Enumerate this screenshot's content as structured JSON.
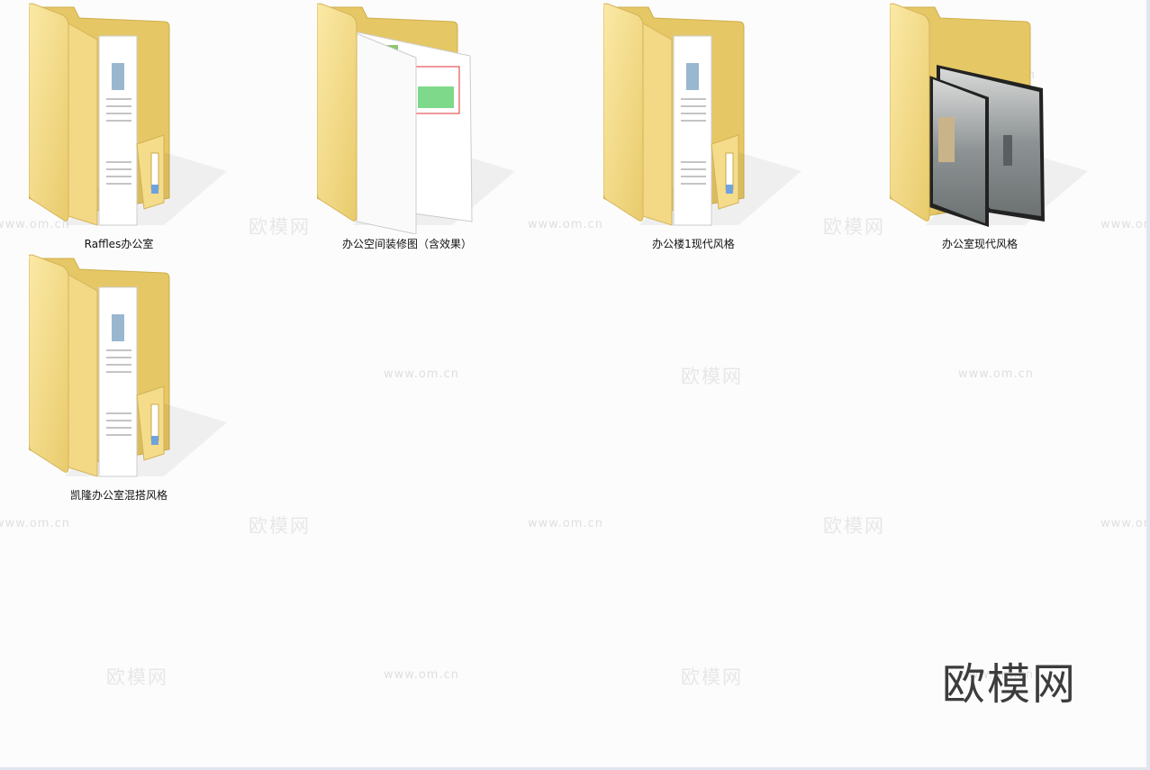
{
  "files": [
    {
      "name": "Raffles办公室",
      "preview": "document-icon"
    },
    {
      "name": "办公空间装修图（含效果）",
      "preview": "drawing-icon"
    },
    {
      "name": "办公楼1现代风格",
      "preview": "document-icon"
    },
    {
      "name": "办公室现代风格",
      "preview": "photo-icon"
    },
    {
      "name": "凯隆办公室混搭风格",
      "preview": "document-icon"
    }
  ],
  "watermark": {
    "brand": "欧模网",
    "url": "www.om.cn"
  },
  "colors": {
    "folder_front": "#f6de8e",
    "folder_back": "#eccd72",
    "background": "#fcfcfc"
  }
}
